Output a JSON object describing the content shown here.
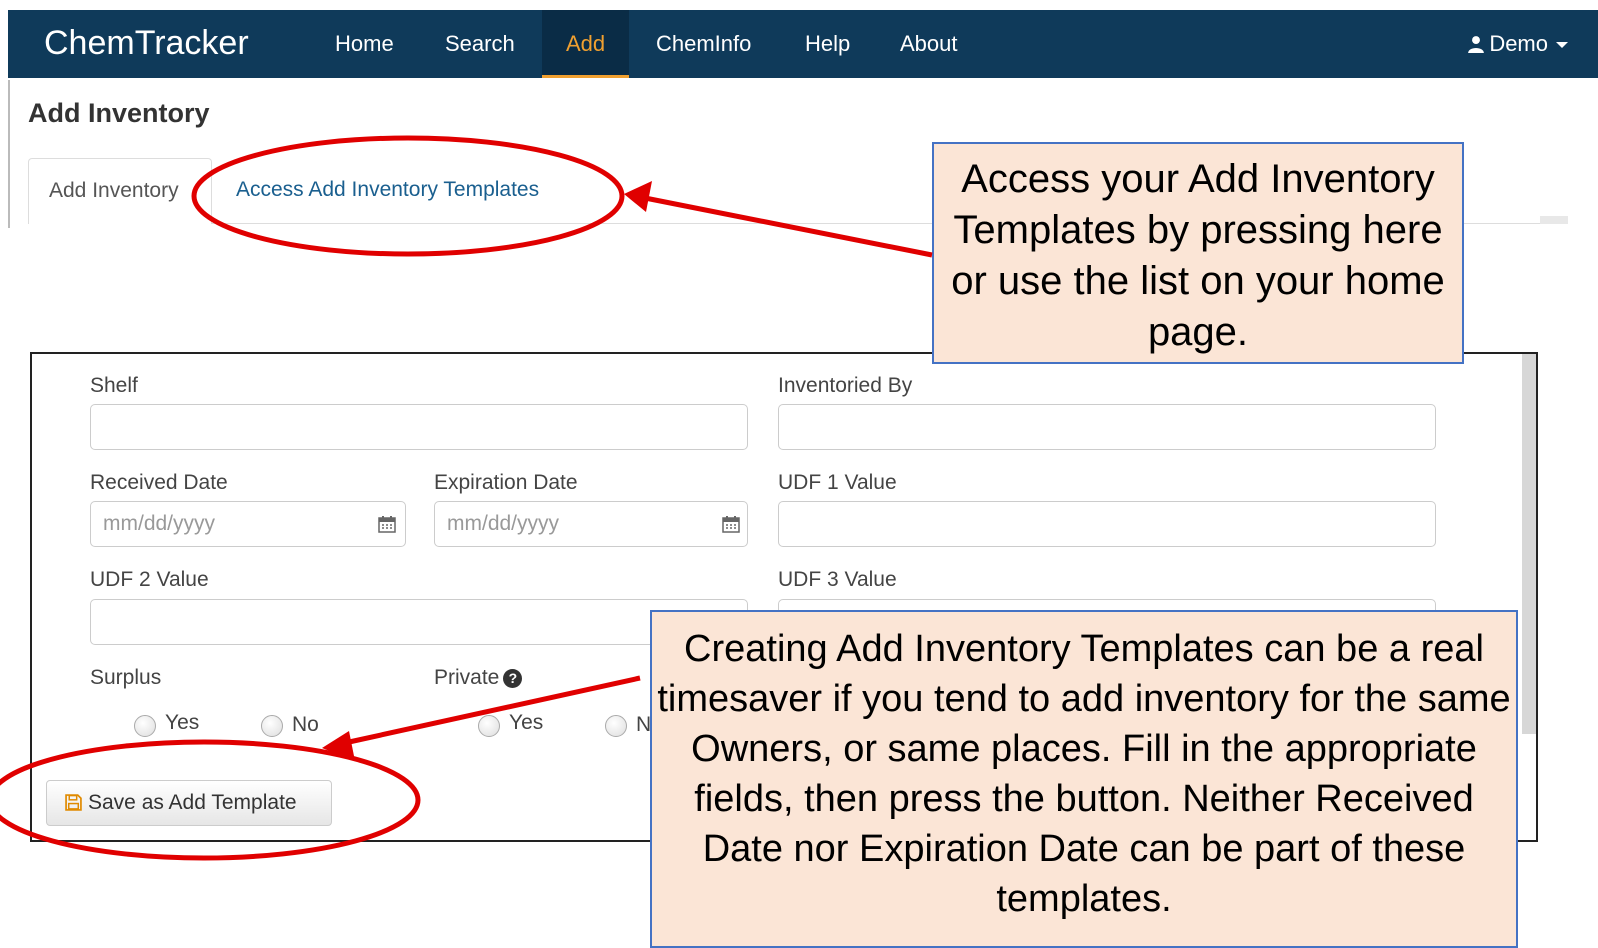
{
  "navbar": {
    "brand": "ChemTracker",
    "items": [
      {
        "label": "Home",
        "active": false
      },
      {
        "label": "Search",
        "active": false
      },
      {
        "label": "Add",
        "active": true
      },
      {
        "label": "ChemInfo",
        "active": false
      },
      {
        "label": "Help",
        "active": false
      },
      {
        "label": "About",
        "active": false
      }
    ],
    "user": "Demo",
    "user_icon": "user-icon",
    "colors": {
      "background": "#0f3a5a",
      "active_text": "#f0a030"
    }
  },
  "page": {
    "title": "Add Inventory",
    "tabs": [
      {
        "label": "Add Inventory",
        "active": true
      },
      {
        "label": "Access Add Inventory Templates",
        "active": false
      }
    ]
  },
  "form": {
    "shelf": {
      "label": "Shelf",
      "value": ""
    },
    "inventoried_by": {
      "label": "Inventoried By",
      "value": ""
    },
    "received_date": {
      "label": "Received Date",
      "placeholder": "mm/dd/yyyy",
      "icon": "calendar-icon"
    },
    "expiration_date": {
      "label": "Expiration Date",
      "placeholder": "mm/dd/yyyy",
      "icon": "calendar-icon"
    },
    "udf1": {
      "label": "UDF 1 Value",
      "value": ""
    },
    "udf2": {
      "label": "UDF 2 Value",
      "value": ""
    },
    "udf3": {
      "label": "UDF 3 Value",
      "value": ""
    },
    "surplus": {
      "label": "Surplus",
      "options": [
        "Yes",
        "No"
      ]
    },
    "private": {
      "label": "Private",
      "options": [
        "Yes",
        "N"
      ],
      "help_icon": "question-circle-icon"
    },
    "save_button": "Save as Add Template",
    "save_icon": "floppy-disk-icon"
  },
  "callouts": {
    "top": "Access your Add Inventory Templates by pressing here or use the list on your home page.",
    "bottom": "Creating Add Inventory Templates can be a real timesaver if you tend to add inventory for the same Owners, or same places.  Fill in the appropriate fields, then press the button. Neither Received Date nor Expiration Date can be part of these templates.",
    "colors": {
      "fill": "#fbe5d6",
      "border": "#4472c4",
      "annotation": "#e00000"
    }
  }
}
